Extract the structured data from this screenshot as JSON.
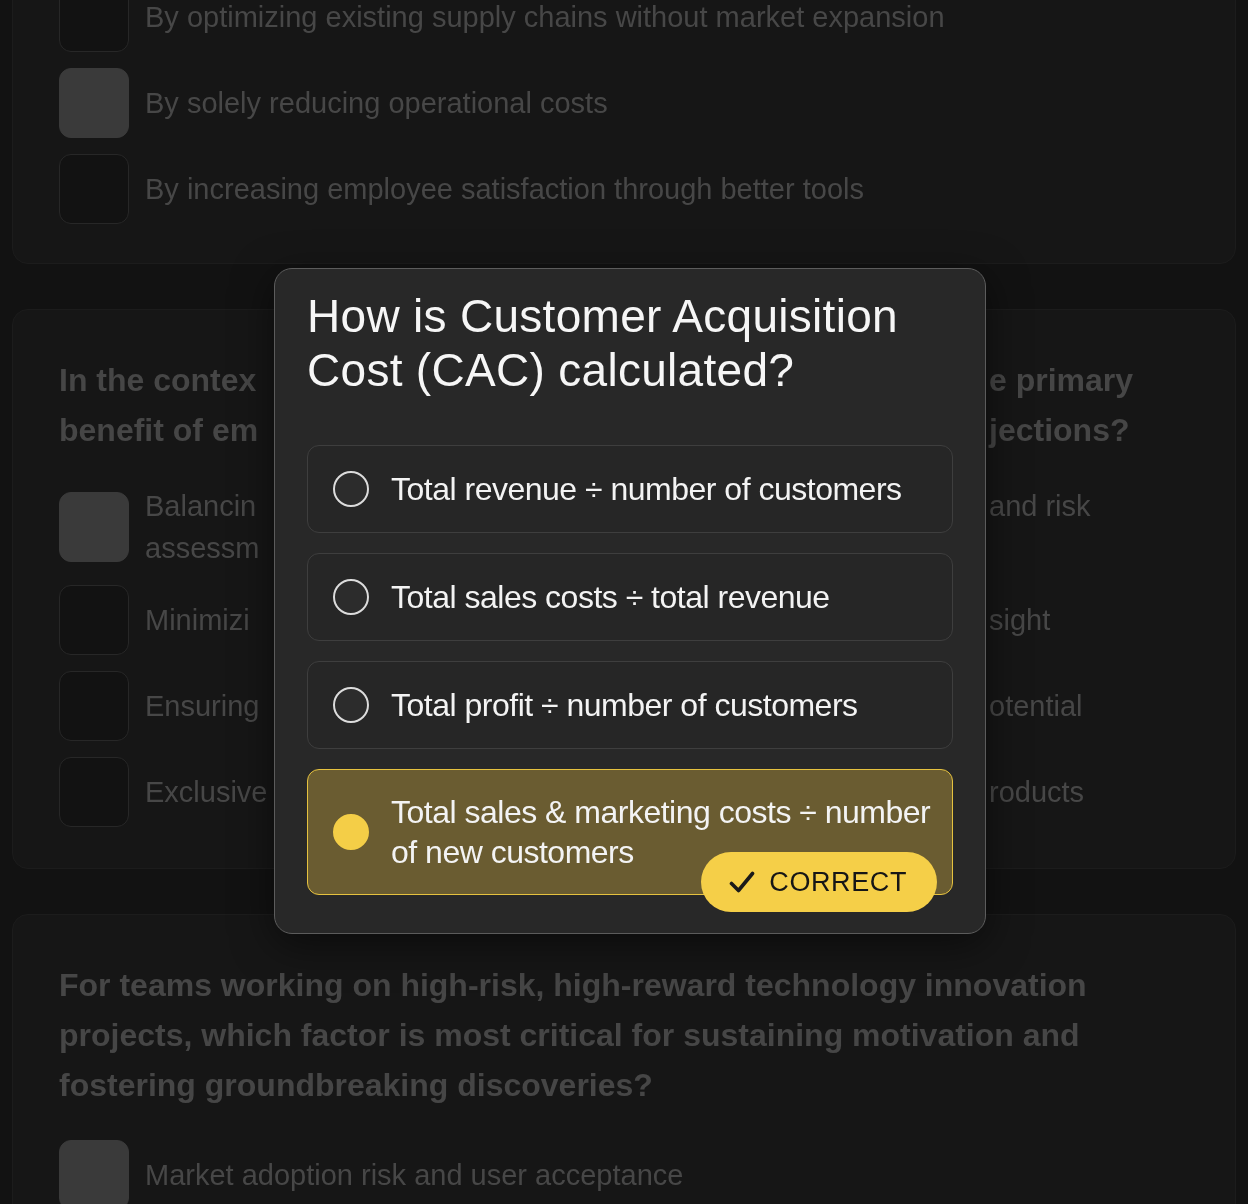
{
  "background_cards": [
    {
      "options": [
        {
          "text": "By optimizing existing supply chains without market expansion",
          "selected": false
        },
        {
          "text": "By solely reducing operational costs",
          "selected": true
        },
        {
          "text": "By increasing employee satisfaction through better tools",
          "selected": false
        }
      ]
    },
    {
      "question_visible": [
        {
          "left": "In the contex",
          "right": "e primary"
        },
        {
          "left": "benefit of em",
          "right": "jections?"
        }
      ],
      "options": [
        {
          "visible": [
            {
              "left": "Balancin",
              "right": "and risk"
            },
            {
              "left": "assessm"
            }
          ],
          "selected": true
        },
        {
          "visible": [
            {
              "left": "Minimizi",
              "right": "sight"
            }
          ],
          "selected": false
        },
        {
          "visible": [
            {
              "left": "Ensuring",
              "right": "otential"
            }
          ],
          "selected": false
        },
        {
          "visible": [
            {
              "left": "Exclusive",
              "right": "roducts"
            }
          ],
          "selected": false
        }
      ]
    },
    {
      "question": "For teams working on high-risk, high-reward technology innovation projects, which factor is most critical for sustaining motivation and fostering groundbreaking discoveries?",
      "options": [
        {
          "text": "Market adoption risk and user acceptance",
          "selected": true
        }
      ]
    }
  ],
  "quiz_card": {
    "question": "How is Customer Acquisition Cost (CAC) calculated?",
    "correct_label": "CORRECT",
    "options": [
      {
        "text": "Total revenue ÷ number of customers",
        "selected": false,
        "correct": false
      },
      {
        "text": "Total sales costs ÷ total revenue",
        "selected": false,
        "correct": false
      },
      {
        "text": "Total profit ÷ number of customers",
        "selected": false,
        "correct": false
      },
      {
        "text": "Total sales & marketing costs ÷ number of new customers",
        "selected": true,
        "correct": true
      }
    ]
  }
}
